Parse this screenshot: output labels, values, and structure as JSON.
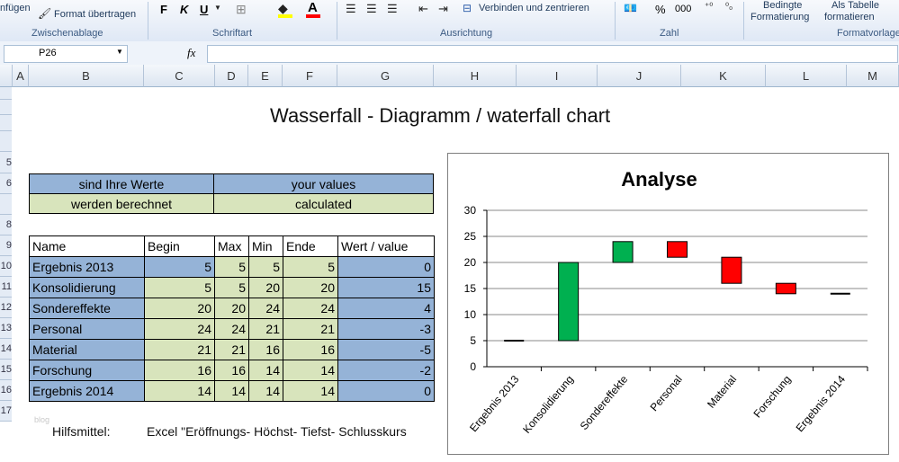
{
  "ribbon": {
    "paste_partial": "nfügen",
    "format_painter": "Format übertragen",
    "group_clipboard": "Zwischenablage",
    "group_font": "Schriftart",
    "group_alignment": "Ausrichtung",
    "group_number": "Zahl",
    "group_styles": "Formatvorlage",
    "bold": "F",
    "italic": "K",
    "underline": "U",
    "merge_center": "Verbinden und zentrieren",
    "percent": "%",
    "thousands": "000",
    "cond_format_1": "Bedingte",
    "cond_format_2": "Formatierung",
    "as_table_1": "Als Tabelle",
    "as_table_2": "formatieren"
  },
  "formula_bar": {
    "name_box": "P26",
    "fx": "fx",
    "content": ""
  },
  "columns": [
    "A",
    "B",
    "C",
    "D",
    "E",
    "F",
    "G",
    "H",
    "I",
    "J",
    "K",
    "L",
    "M"
  ],
  "rows": [
    "",
    "",
    "",
    "",
    "5",
    "6",
    "",
    "8",
    "9",
    "10",
    "11",
    "12",
    "13",
    "14",
    "15",
    "16",
    "17"
  ],
  "sheet": {
    "title": "Wasserfall - Diagramm / waterfall chart",
    "legend_rows": [
      [
        "sind Ihre Werte",
        "your values"
      ],
      [
        "werden berechnet",
        "calculated"
      ]
    ],
    "table_headers": [
      "Name",
      "Begin",
      "Max",
      "Min",
      "Ende",
      "Wert / value"
    ],
    "table_rows": [
      [
        "Ergebnis 2013",
        "5",
        "5",
        "5",
        "5",
        "0"
      ],
      [
        "Konsolidierung",
        "5",
        "5",
        "20",
        "20",
        "15"
      ],
      [
        "Sondereffekte",
        "20",
        "20",
        "24",
        "24",
        "4"
      ],
      [
        "Personal",
        "24",
        "24",
        "21",
        "21",
        "-3"
      ],
      [
        "Material",
        "21",
        "21",
        "16",
        "16",
        "-5"
      ],
      [
        "Forschung",
        "16",
        "16",
        "14",
        "14",
        "-2"
      ],
      [
        "Ergebnis 2014",
        "14",
        "14",
        "14",
        "14",
        "0"
      ]
    ],
    "footer_label": "Hilfsmittel:",
    "footer_text": "Excel \"Eröffnungs- Höchst- Tiefst- Schlusskurs",
    "watermark": "blog"
  },
  "colors": {
    "blue": "#95b3d7",
    "green": "#d8e4bc",
    "up": "#00b050",
    "down": "#ff0000"
  },
  "chart_data": {
    "type": "bar",
    "title": "Analyse",
    "categories": [
      "Ergebnis 2013",
      "Konsolidierung",
      "Sondereffekte",
      "Personal",
      "Material",
      "Forschung",
      "Ergebnis 2014"
    ],
    "series": [
      {
        "values": [
          [
            5,
            5
          ],
          [
            5,
            20
          ],
          [
            20,
            24
          ],
          [
            24,
            21
          ],
          [
            21,
            16
          ],
          [
            16,
            14
          ],
          [
            14,
            14
          ]
        ]
      }
    ],
    "ylim": [
      0,
      30
    ],
    "yticks": [
      "0",
      "5",
      "10",
      "15",
      "20",
      "25",
      "30"
    ],
    "grid": true
  }
}
